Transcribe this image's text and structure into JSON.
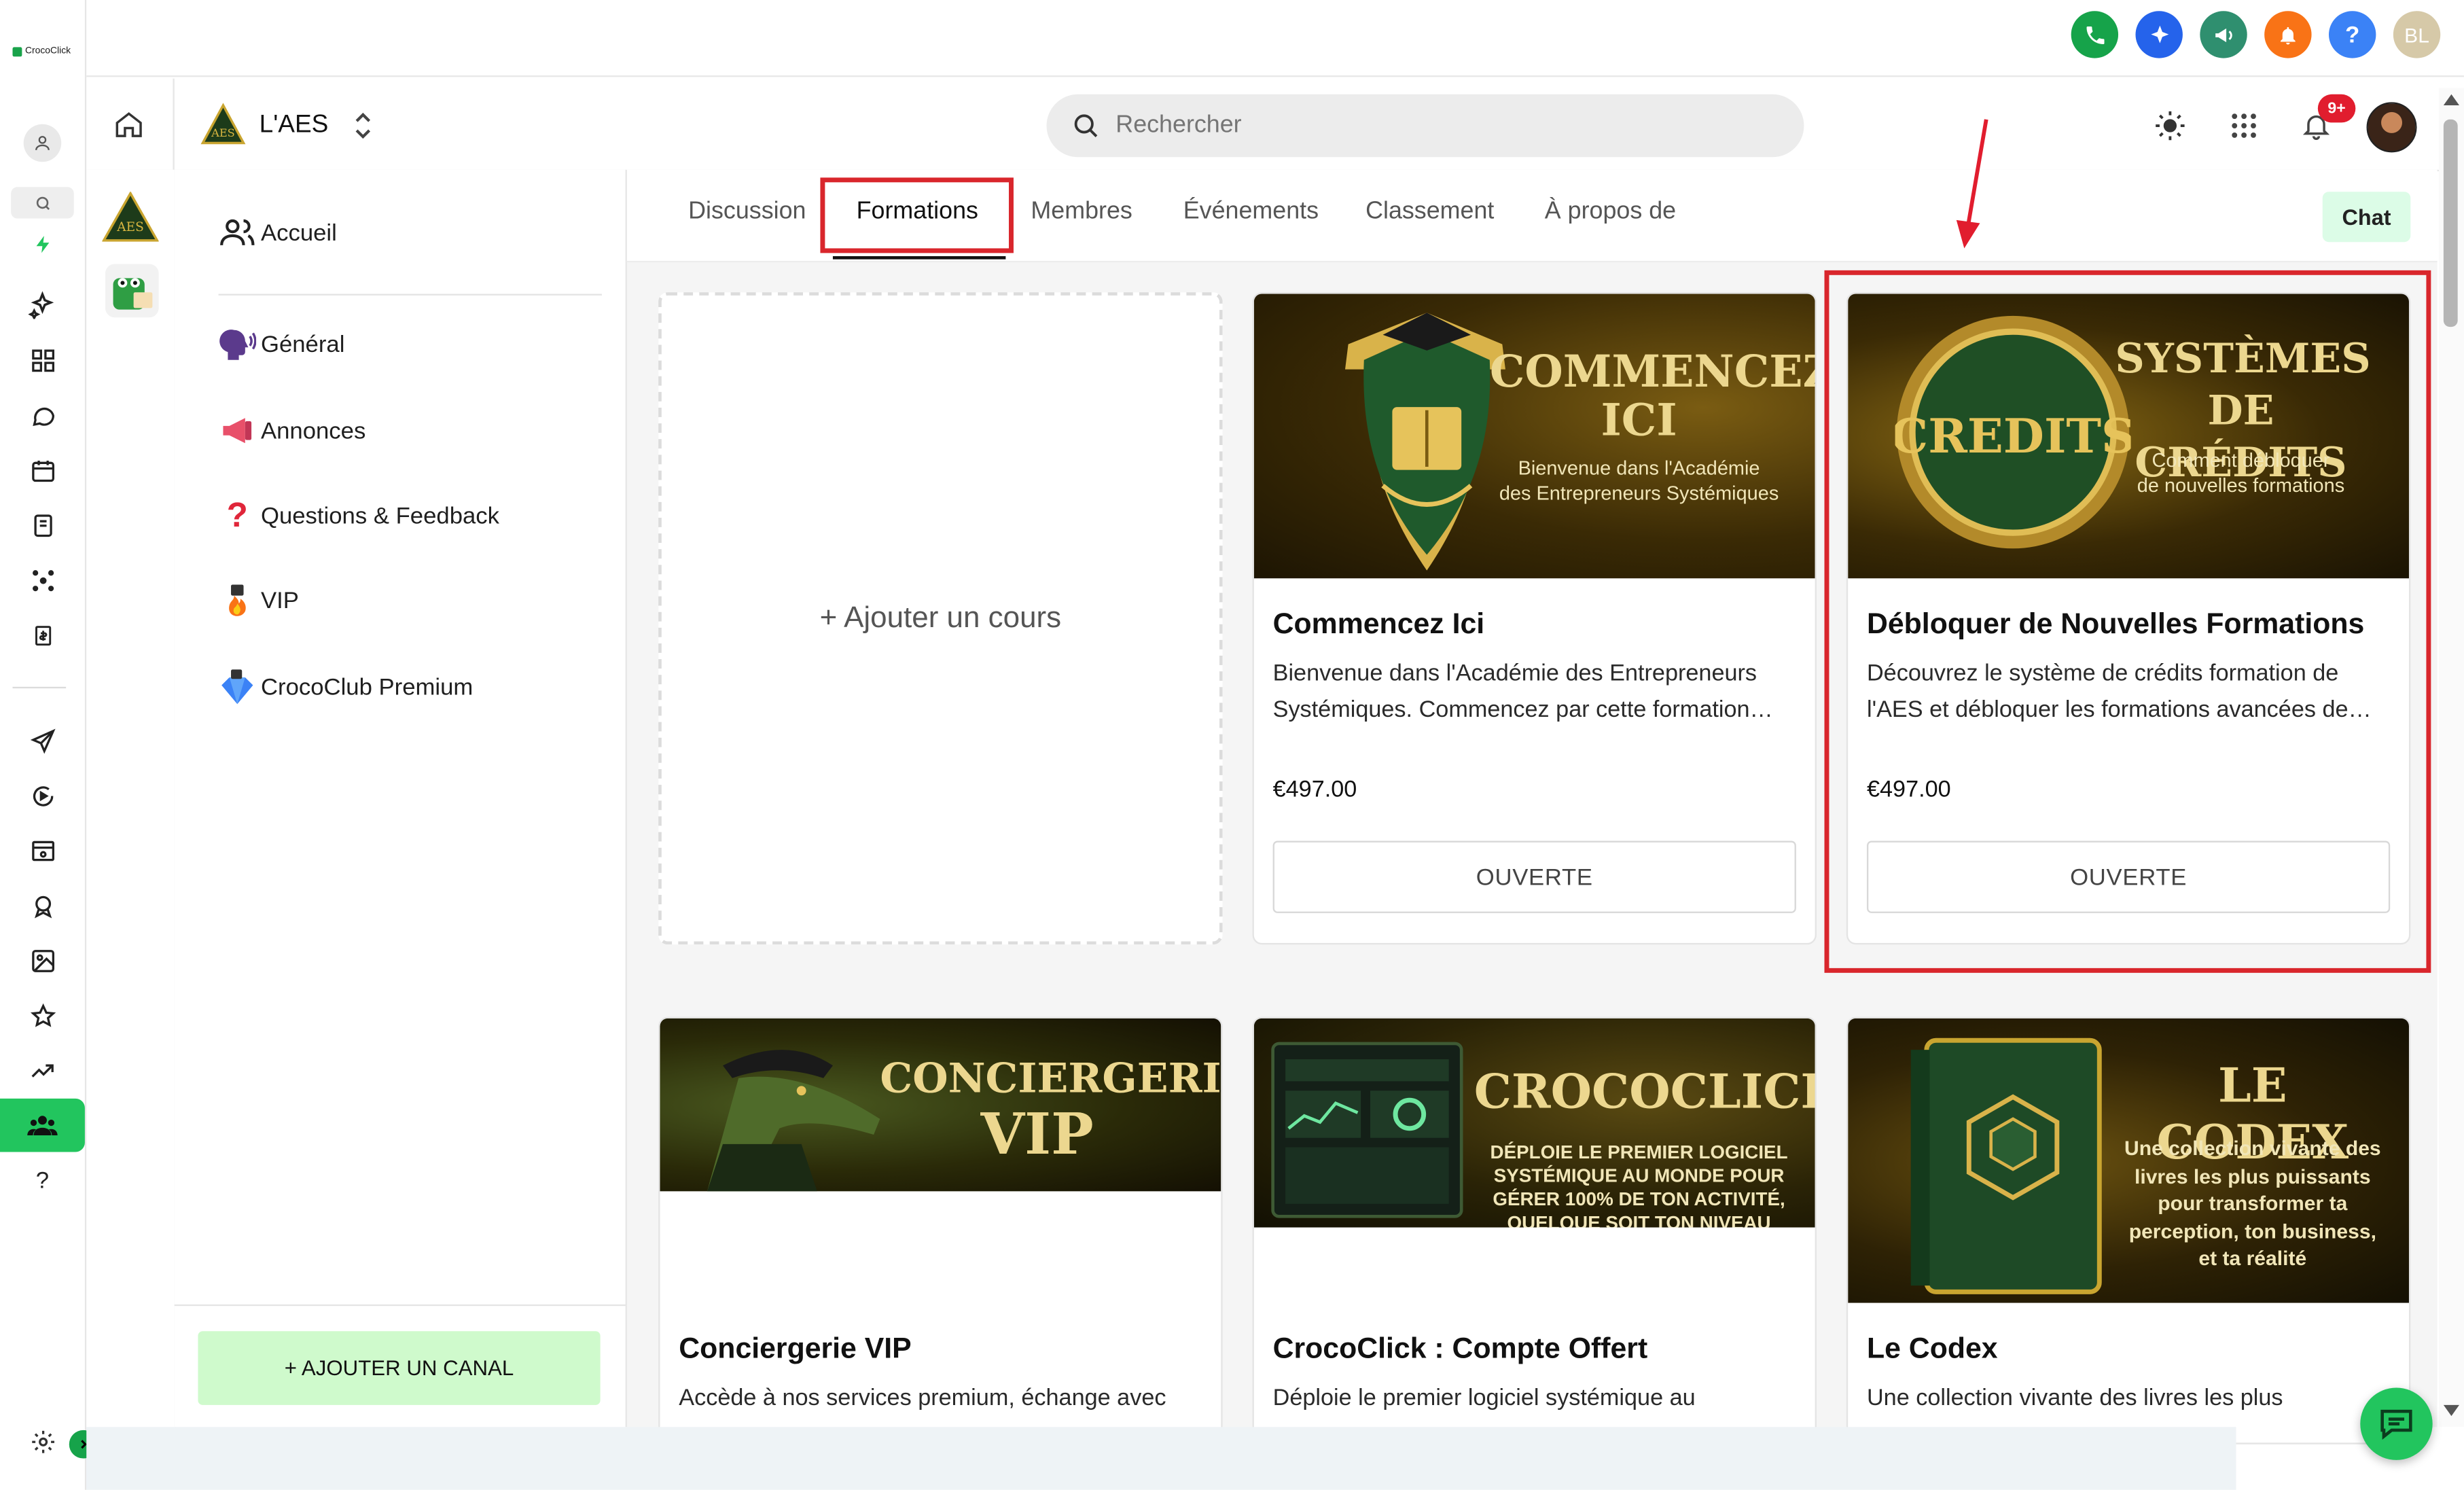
{
  "app": {
    "brand": "CrocoClick"
  },
  "topbar": {
    "icons": [
      "phone-icon",
      "sparkle-icon",
      "megaphone-icon",
      "bell-icon",
      "help-icon"
    ],
    "user_initials": "BL"
  },
  "community": {
    "name": "L'AES",
    "search_placeholder": "Rechercher",
    "notifications_badge": "9+",
    "logo_text": "AES"
  },
  "sidebar": {
    "items": [
      {
        "label": "Accueil",
        "icon": "people-icon"
      },
      {
        "label": "Général",
        "icon": "speaking-head-icon"
      },
      {
        "label": "Annonces",
        "icon": "megaphone-icon"
      },
      {
        "label": "Questions & Feedback",
        "icon": "question-mark-icon"
      },
      {
        "label": "VIP",
        "icon": "lock-fire-icon"
      },
      {
        "label": "CrocoClub Premium",
        "icon": "lock-diamond-icon"
      }
    ],
    "add_channel_label": "+ AJOUTER UN CANAL"
  },
  "tabs": [
    "Discussion",
    "Formations",
    "Membres",
    "Événements",
    "Classement",
    "À propos de"
  ],
  "active_tab": "Formations",
  "chat_button": "Chat",
  "add_course_label": "+ Ajouter un cours",
  "courses": [
    {
      "thumb_title_1": "COMMENCEZ",
      "thumb_title_2": "ICI",
      "thumb_sub_1": "Bienvenue dans l'Académie",
      "thumb_sub_2": "des Entrepreneurs Systémiques",
      "title": "Commencez Ici",
      "desc": "Bienvenue dans l'Académie des Entrepreneurs Systémiques. Commencez par cette formation…",
      "price": "€497.00",
      "button": "OUVERTE"
    },
    {
      "thumb_badge": "CREDITS",
      "thumb_title_1": "SYSTÈMES",
      "thumb_title_2": "DE CRÉDITS",
      "thumb_sub_1": "Comment débloquer",
      "thumb_sub_2": "de nouvelles formations",
      "title": "Débloquer de Nouvelles Formations",
      "desc": "Découvrez le système de crédits formation de l'AES et débloquer les formations avancées de…",
      "price": "€497.00",
      "button": "OUVERTE"
    },
    {
      "thumb_title_1": "CONCIERGERIE",
      "thumb_title_2": "VIP",
      "title": "Conciergerie VIP",
      "desc": "Accède à nos services premium, échange avec"
    },
    {
      "thumb_title_1": "CROCOCLICK",
      "thumb_sub_1": "DÉPLOIE LE PREMIER LOGICIEL",
      "thumb_sub_2": "SYSTÉMIQUE AU MONDE POUR",
      "thumb_sub_3": "GÉRER 100% DE TON ACTIVITÉ,",
      "thumb_sub_4": "QUELQUE SOIT TON NIVEAU",
      "title": "CrocoClick : Compte Offert",
      "desc": "Déploie le premier logiciel systémique au"
    },
    {
      "thumb_title_1": "LE CODEX",
      "thumb_sub_1": "Une collection vivante des",
      "thumb_sub_2": "livres les plus puissants",
      "thumb_sub_3": "pour transformer ta",
      "thumb_sub_4": "perception, ton business,",
      "thumb_sub_5": "et ta réalité",
      "title": "Le Codex",
      "desc": "Une collection vivante des livres les plus"
    }
  ],
  "colors": {
    "brand_green": "#19a34a",
    "active_rail_bg": "#22c55e",
    "annotation_red": "#d9262c",
    "chat_bg": "#dcfce7"
  }
}
